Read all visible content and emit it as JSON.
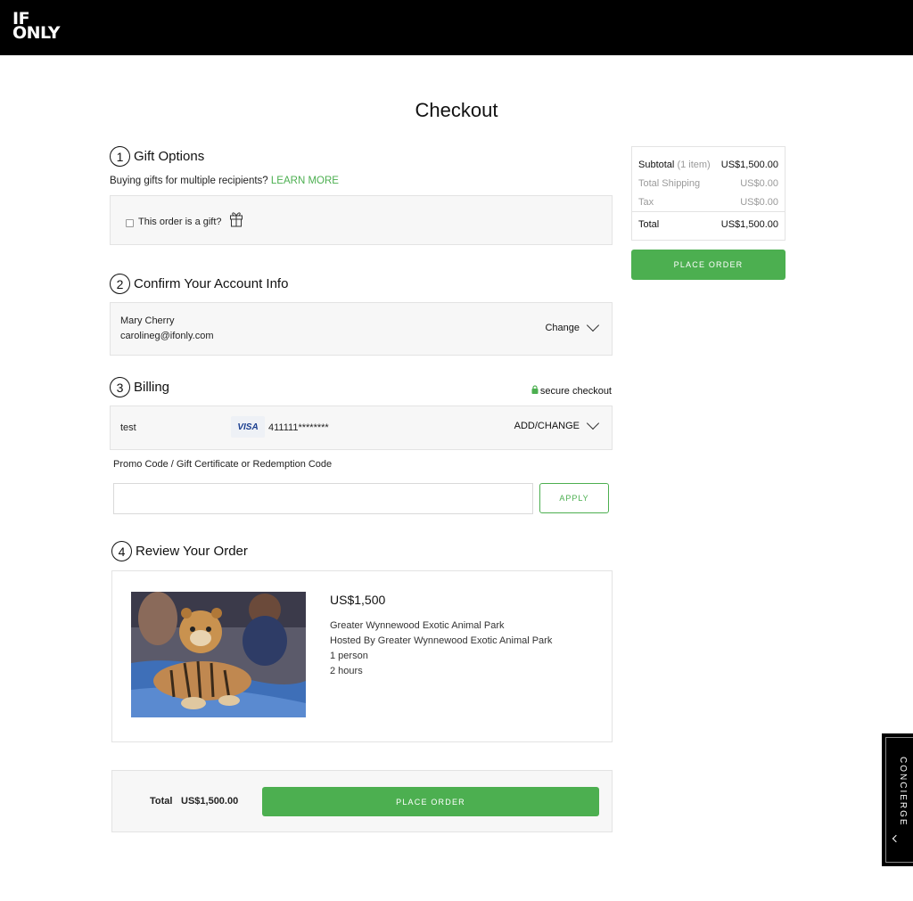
{
  "brand": {
    "logo_line1": "IF",
    "logo_line2": "ONLY"
  },
  "page": {
    "title": "Checkout"
  },
  "gift_options": {
    "step": "1",
    "heading": "Gift Options",
    "question": "Buying gifts for multiple recipients?",
    "learn_more": "LEARN MORE",
    "checkbox_label": "This order is a gift?"
  },
  "account": {
    "step": "2",
    "heading": "Confirm Your Account Info",
    "name": "Mary Cherry",
    "email": "carolineg@ifonly.com",
    "change_label": "Change"
  },
  "billing": {
    "step": "3",
    "heading": "Billing",
    "secure_label": "secure checkout",
    "card_name": "test",
    "card_brand": "VISA",
    "card_number": "411111********",
    "add_change_label": "ADD/CHANGE",
    "promo_label": "Promo Code / Gift Certificate or Redemption Code",
    "promo_value": "",
    "apply_label": "APPLY"
  },
  "review": {
    "step": "4",
    "heading": "Review Your Order",
    "price": "US$1,500",
    "title": "Greater Wynnewood Exotic Animal Park",
    "host": "Hosted By Greater Wynnewood Exotic Animal Park",
    "guests": "1 person",
    "duration": "2 hours",
    "image": "tiger-cub-photo"
  },
  "bottom_bar": {
    "total_label": "Total",
    "total_value": "US$1,500.00",
    "place_order_label": "PLACE ORDER"
  },
  "summary": {
    "subtotal_label": "Subtotal",
    "subtotal_count": "(1 item)",
    "subtotal_value": "US$1,500.00",
    "shipping_label": "Total Shipping",
    "shipping_value": "US$0.00",
    "tax_label": "Tax",
    "tax_value": "US$0.00",
    "total_label": "Total",
    "total_value": "US$1,500.00",
    "place_order_label": "PLACE ORDER"
  },
  "concierge": {
    "label": "CONCIERGE"
  },
  "colors": {
    "accent": "#4caf50",
    "topbar": "#000000",
    "panel": "#f7f7f7"
  }
}
